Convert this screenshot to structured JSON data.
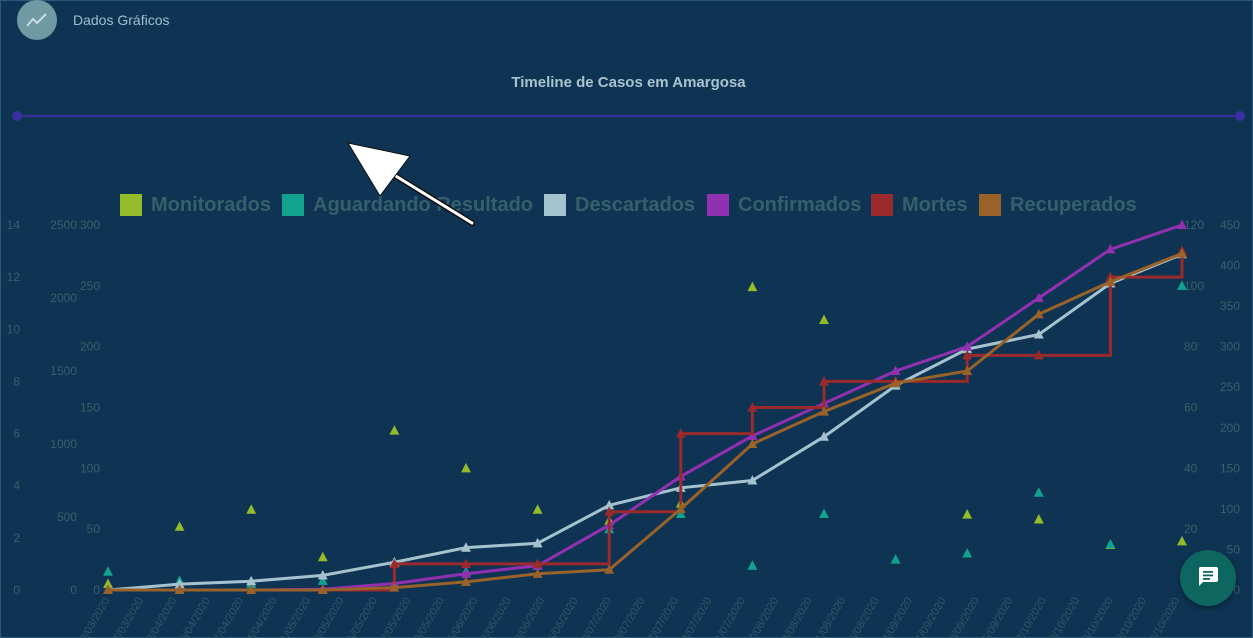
{
  "app": {
    "title": "Dados Gráficos",
    "icon": "trending-up-icon"
  },
  "timeline": {
    "title": "Timeline de Casos em Amargosa"
  },
  "fab": {
    "icon": "chat-icon"
  },
  "colors": {
    "background": "#0f3453",
    "slider": "#3a2fa0",
    "fab": "#0e6660"
  },
  "chart_data": {
    "type": "line",
    "title": "",
    "legend_position": "top",
    "grid": false,
    "x": [
      "31/03/2020",
      "13/04/2020",
      "27/04/2020",
      "11/05/2020",
      "25/05/2020",
      "08/06/2020",
      "22/06/2020",
      "06/07/2020",
      "20/07/2020",
      "03/08/2020",
      "17/08/2020",
      "31/08/2020",
      "14/09/2020",
      "28/09/2020",
      "12/10/2020",
      "26/10/2020"
    ],
    "x_ticks_visible": [
      "20/03/2020",
      "27/03/2020",
      "03/04/2020",
      "10/04/2020",
      "17/04/2020",
      "24/04/2020",
      "01/05/2020",
      "08/05/2020",
      "15/05/2020",
      "22/05/2020",
      "29/05/2020",
      "05/06/2020",
      "12/06/2020",
      "19/06/2020",
      "26/06/2020",
      "03/07/2020",
      "10/07/2020",
      "17/07/2020",
      "24/07/2020",
      "31/07/2020",
      "07/08/2020",
      "14/08/2020",
      "21/08/2020",
      "28/08/2020",
      "04/09/2020",
      "11/09/2020",
      "18/09/2020",
      "25/09/2020",
      "02/10/2020",
      "09/10/2020",
      "16/10/2020",
      "23/10/2020",
      "30/10/2020"
    ],
    "axes": [
      {
        "id": "mortes",
        "side": "left",
        "ticks": [
          0,
          2,
          4,
          6,
          8,
          10,
          12,
          14
        ],
        "ylim": [
          0,
          14
        ]
      },
      {
        "id": "descartados",
        "side": "left",
        "ticks": [
          0,
          500,
          1000,
          1500,
          2000,
          2500
        ],
        "ylim": [
          0,
          2500
        ]
      },
      {
        "id": "monitorados",
        "side": "left",
        "ticks": [
          0,
          50,
          100,
          150,
          200,
          250,
          300
        ],
        "ylim": [
          0,
          300
        ]
      },
      {
        "id": "aguardando",
        "side": "right",
        "ticks": [
          0,
          20,
          40,
          60,
          80,
          100,
          120
        ],
        "ylim": [
          0,
          120
        ]
      },
      {
        "id": "confirmados",
        "side": "right",
        "ticks": [
          0,
          50,
          100,
          150,
          200,
          250,
          300,
          350,
          400,
          450
        ],
        "ylim": [
          0,
          450
        ]
      }
    ],
    "series": [
      {
        "name": "Monitorados",
        "color": "#93bb2a",
        "axis": "monitorados",
        "style": "markers",
        "values": [
          5,
          52,
          66,
          27,
          131,
          100,
          66,
          57,
          71,
          249,
          222,
          170,
          62,
          58,
          37,
          40
        ]
      },
      {
        "name": "Aguardando Resultado",
        "color": "#11a38e",
        "axis": "aguardando",
        "style": "markers",
        "values": [
          6,
          3,
          2,
          3,
          9,
          6,
          8,
          20,
          25,
          8,
          25,
          10,
          12,
          32,
          15,
          100
        ]
      },
      {
        "name": "Descartados",
        "color": "#a5c3cf",
        "axis": "descartados",
        "style": "line-markers",
        "values": [
          0,
          40,
          60,
          100,
          190,
          290,
          320,
          580,
          700,
          750,
          1050,
          1400,
          1650,
          1750,
          2100,
          2300
        ]
      },
      {
        "name": "Confirmados",
        "color": "#9230b2",
        "axis": "confirmados",
        "style": "line-markers",
        "values": [
          0,
          0,
          0,
          1,
          8,
          20,
          30,
          80,
          140,
          190,
          230,
          270,
          300,
          360,
          420,
          450
        ]
      },
      {
        "name": "Mortes",
        "color": "#9a2a2b",
        "axis": "mortes",
        "style": "step",
        "values": [
          0,
          0,
          0,
          0,
          1,
          1,
          1,
          3,
          6,
          7,
          8,
          8,
          9,
          9,
          12,
          13
        ]
      },
      {
        "name": "Recuperados",
        "color": "#986228",
        "axis": "confirmados",
        "style": "line-markers",
        "values": [
          0,
          0,
          0,
          0,
          3,
          10,
          20,
          25,
          100,
          180,
          220,
          255,
          270,
          340,
          380,
          415
        ]
      }
    ]
  }
}
